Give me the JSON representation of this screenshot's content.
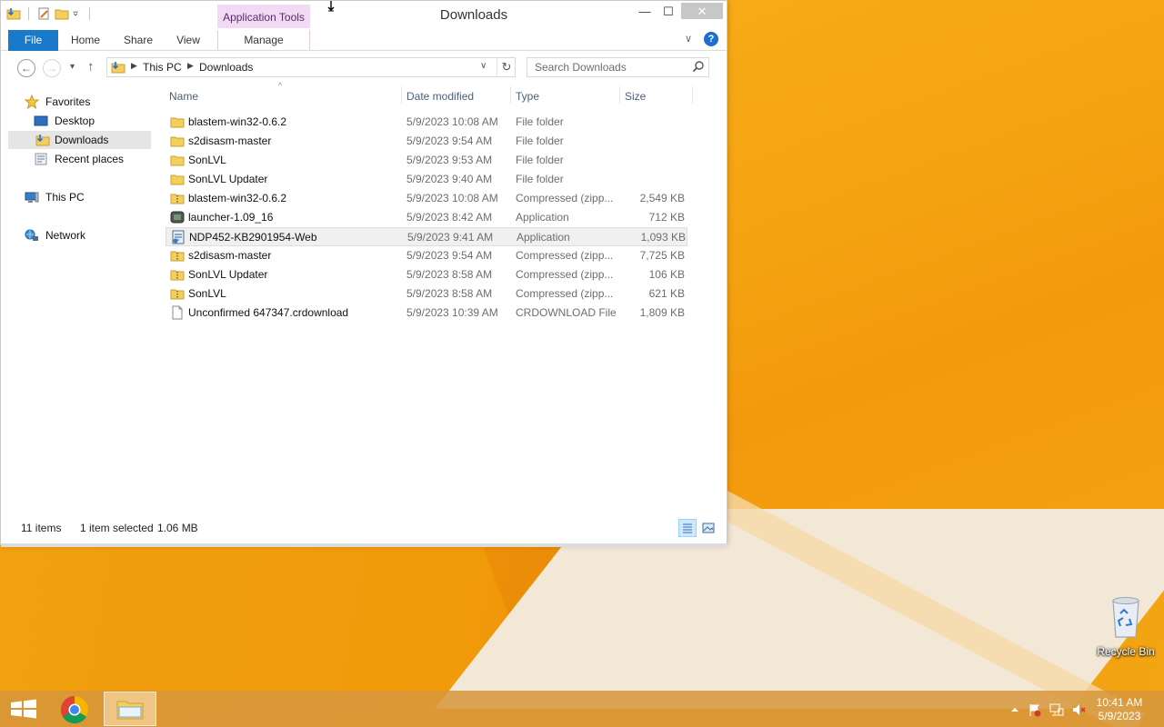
{
  "window": {
    "title": "Downloads",
    "context_tab_group": "Application Tools",
    "minimize": "—",
    "maximize": "☐",
    "close": "✕"
  },
  "ribbon": {
    "tabs": [
      {
        "label": "File"
      },
      {
        "label": "Home"
      },
      {
        "label": "Share"
      },
      {
        "label": "View"
      },
      {
        "label": "Manage"
      }
    ],
    "help": "?"
  },
  "address": {
    "crumbs": [
      "This PC",
      "Downloads"
    ]
  },
  "search": {
    "placeholder": "Search Downloads"
  },
  "nav": {
    "items": [
      {
        "label": "Favorites",
        "icon": "star-icon"
      },
      {
        "label": "Desktop",
        "icon": "desktop-icon"
      },
      {
        "label": "Downloads",
        "icon": "downloads-folder-icon",
        "selected": true
      },
      {
        "label": "Recent places",
        "icon": "recent-places-icon"
      },
      {
        "label": "This PC",
        "icon": "computer-icon"
      },
      {
        "label": "Network",
        "icon": "network-icon"
      }
    ]
  },
  "columns": [
    "Name",
    "Date modified",
    "Type",
    "Size"
  ],
  "files": [
    {
      "name": "blastem-win32-0.6.2",
      "date": "5/9/2023 10:08 AM",
      "type": "File folder",
      "size": "",
      "icon": "folder-icon"
    },
    {
      "name": "s2disasm-master",
      "date": "5/9/2023 9:54 AM",
      "type": "File folder",
      "size": "",
      "icon": "folder-icon"
    },
    {
      "name": "SonLVL",
      "date": "5/9/2023 9:53 AM",
      "type": "File folder",
      "size": "",
      "icon": "folder-icon"
    },
    {
      "name": "SonLVL Updater",
      "date": "5/9/2023 9:40 AM",
      "type": "File folder",
      "size": "",
      "icon": "folder-icon"
    },
    {
      "name": "blastem-win32-0.6.2",
      "date": "5/9/2023 10:08 AM",
      "type": "Compressed (zipp...",
      "size": "2,549 KB",
      "icon": "zip-folder-icon"
    },
    {
      "name": "launcher-1.09_16",
      "date": "5/9/2023 8:42 AM",
      "type": "Application",
      "size": "712 KB",
      "icon": "launcher-app-icon"
    },
    {
      "name": "NDP452-KB2901954-Web",
      "date": "5/9/2023 9:41 AM",
      "type": "Application",
      "size": "1,093 KB",
      "icon": "installer-app-icon",
      "selected": true
    },
    {
      "name": "s2disasm-master",
      "date": "5/9/2023 9:54 AM",
      "type": "Compressed (zipp...",
      "size": "7,725 KB",
      "icon": "zip-folder-icon"
    },
    {
      "name": "SonLVL Updater",
      "date": "5/9/2023 8:58 AM",
      "type": "Compressed (zipp...",
      "size": "106 KB",
      "icon": "zip-folder-icon"
    },
    {
      "name": "SonLVL",
      "date": "5/9/2023 8:58 AM",
      "type": "Compressed (zipp...",
      "size": "621 KB",
      "icon": "zip-folder-icon"
    },
    {
      "name": "Unconfirmed 647347.crdownload",
      "date": "5/9/2023 10:39 AM",
      "type": "CRDOWNLOAD File",
      "size": "1,809 KB",
      "icon": "blank-file-icon"
    }
  ],
  "status": {
    "item_count": "11 items",
    "selection": "1 item selected",
    "selection_size": "1.06 MB"
  },
  "desktop": {
    "recycle_bin": "Recycle Bin"
  },
  "taskbar": {
    "time": "10:41 AM",
    "date": "5/9/2023"
  }
}
